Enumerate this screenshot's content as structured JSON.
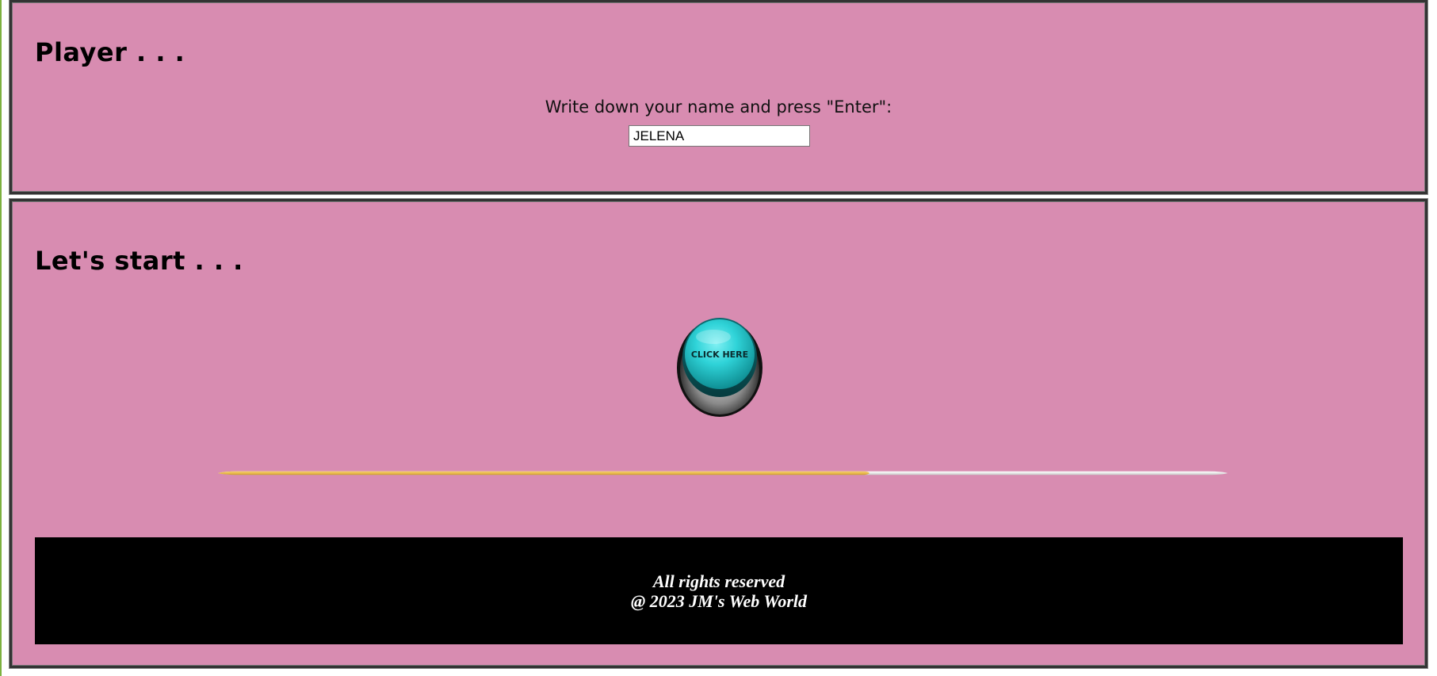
{
  "player_section": {
    "heading": "Player . . .",
    "prompt": "Write down your name and press \"Enter\":",
    "name_value": "JELENA"
  },
  "start_section": {
    "heading": "Let's start . . .",
    "button_label": "CLICK HERE",
    "button_icon": "round-push-button-icon",
    "progress_fraction": 0.645
  },
  "footer": {
    "line1": "All rights reserved",
    "line2": "@ 2023 JM's Web World"
  },
  "colors": {
    "panel_background": "#d88cb1",
    "button_cyan": "#2fd3d8",
    "progress_fill": "#e8b84a",
    "progress_track": "#f1f1f1",
    "footer_background": "#000000"
  }
}
